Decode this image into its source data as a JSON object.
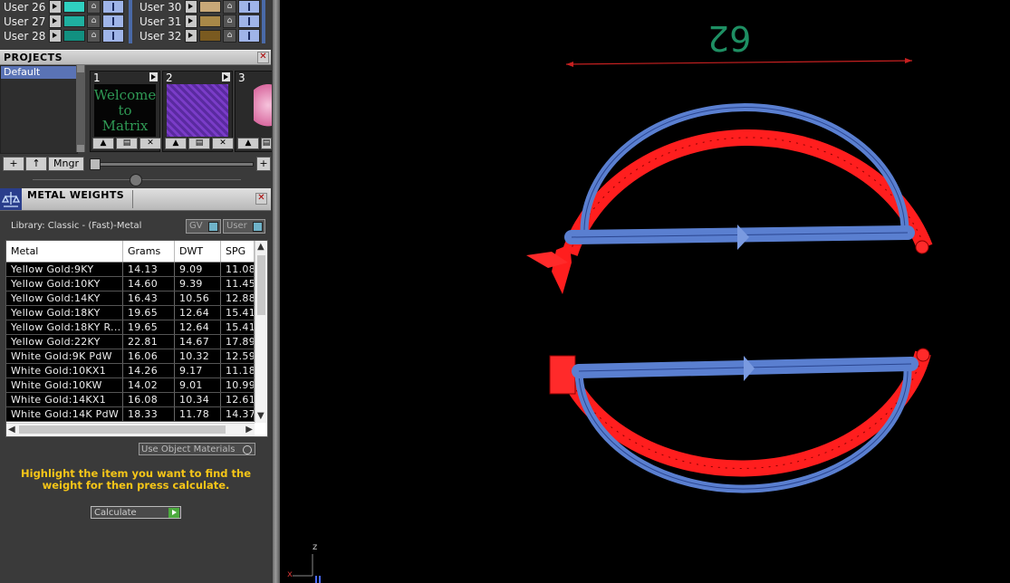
{
  "users_left": [
    {
      "label": "User 26",
      "color": "#2fd0c0"
    },
    {
      "label": "User 27",
      "color": "#1fb0a0"
    },
    {
      "label": "User 28",
      "color": "#129080"
    }
  ],
  "users_right": [
    {
      "label": "User 30",
      "color": "#c8a878"
    },
    {
      "label": "User 31",
      "color": "#a88848"
    },
    {
      "label": "User 32",
      "color": "#7a5a20"
    }
  ],
  "projects": {
    "title": "PROJECTS",
    "list": [
      "Default"
    ],
    "thumbs": [
      {
        "num": "1",
        "caption": "Welcome to Matrix"
      },
      {
        "num": "2"
      },
      {
        "num": "3"
      }
    ],
    "buttons": {
      "add": "+",
      "up": "↑",
      "mngr": "Mngr",
      "plus": "+"
    }
  },
  "metal_weights": {
    "title": "METAL WEIGHTS",
    "library": "Library: Classic - (Fast)-Metal",
    "gv_label": "GV",
    "user_label": "User",
    "columns": [
      "Metal",
      "Grams",
      "DWT",
      "SPG"
    ],
    "rows": [
      [
        "Yellow Gold:9KY",
        "14.13",
        "9.09",
        "11.08"
      ],
      [
        "Yellow Gold:10KY",
        "14.60",
        "9.39",
        "11.45"
      ],
      [
        "Yellow Gold:14KY",
        "16.43",
        "10.56",
        "12.88"
      ],
      [
        "Yellow Gold:18KY",
        "19.65",
        "12.64",
        "15.41"
      ],
      [
        "Yellow Gold:18KY R...",
        "19.65",
        "12.64",
        "15.41"
      ],
      [
        "Yellow Gold:22KY",
        "22.81",
        "14.67",
        "17.89"
      ],
      [
        "White Gold:9K PdW",
        "16.06",
        "10.32",
        "12.59"
      ],
      [
        "White Gold:10KX1",
        "14.26",
        "9.17",
        "11.18"
      ],
      [
        "White Gold:10KW",
        "14.02",
        "9.01",
        "10.99"
      ],
      [
        "White Gold:14KX1",
        "16.08",
        "10.34",
        "12.61"
      ],
      [
        "White Gold:14K PdW",
        "18.33",
        "11.78",
        "14.37"
      ]
    ],
    "use_object_materials": "Use Object Materials",
    "hint": "Highlight the item you want to find the weight for then press calculate.",
    "calculate": "Calculate"
  },
  "viewport": {
    "dimension": "62",
    "axis_z": "z",
    "axis_x": "x"
  }
}
